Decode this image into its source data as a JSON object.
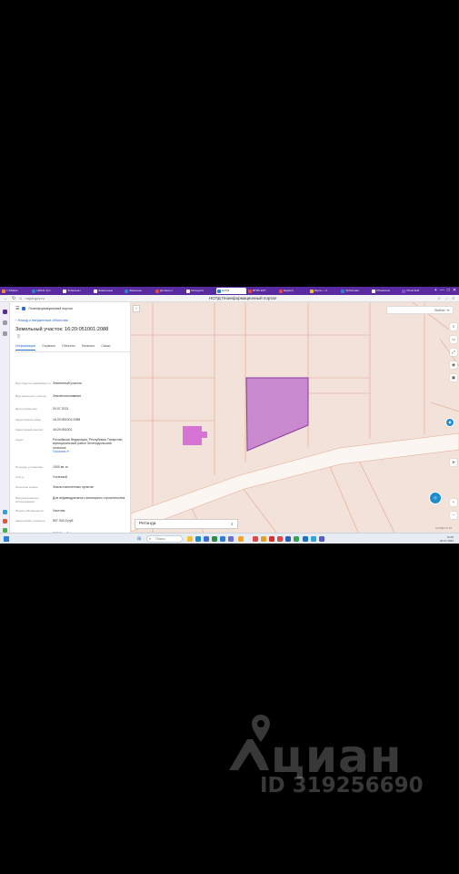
{
  "browser": {
    "tabs": [
      {
        "label": "Р. Абакан",
        "color": "#f28b30"
      },
      {
        "label": "ЦИАН: Куп",
        "color": "#2b7fd6"
      },
      {
        "label": "Земельны",
        "color": "#ffffff"
      },
      {
        "label": "Земельные",
        "color": "#ffffff"
      },
      {
        "label": "Земельны",
        "color": "#2b7fd6"
      },
      {
        "label": "Договор о",
        "color": "#e04848"
      },
      {
        "label": "Калькулят",
        "color": "#ffffff"
      },
      {
        "label": "НСПД",
        "color": "#2b7fd6",
        "active": true
      },
      {
        "label": "ФГИС ЕГР",
        "color": "#e04848"
      },
      {
        "label": "Кадастр",
        "color": "#e04848"
      },
      {
        "label": "Карта — 2",
        "color": "#f2c230"
      },
      {
        "label": "Публичная",
        "color": "#2b7fd6"
      },
      {
        "label": "Объявлени",
        "color": "#ffffff"
      },
      {
        "label": "Photo Edit",
        "color": "#8a4ad6"
      }
    ],
    "window_controls": [
      "+",
      "—",
      "□",
      "✕"
    ],
    "url": "nspd.gov.ru",
    "page_title": "НСПД Геоинформационный портал"
  },
  "panel": {
    "brand": "Геоинформационный портал",
    "back_link": "Назад к найденным объектам",
    "title": "Земельный участок: 16:20:051001:2088",
    "tabs": [
      "Информация",
      "Сервисы",
      "Объекты",
      "Наличие",
      "Связи"
    ],
    "rows": [
      {
        "label": "Вид объекта недвижимости",
        "value": "Земельный участок"
      },
      {
        "label": "Вид земельного участка",
        "value": "Землепользование"
      },
      {
        "label": "Дата присвоения",
        "value": "20.07.2021"
      },
      {
        "label": "Кадастровый номер",
        "value": "16:20:051001:2088"
      },
      {
        "label": "Кадастровый квартал",
        "value": "16:20:051001"
      },
      {
        "label": "Адрес",
        "value": "Российская Федерация, Республика Татарстан, муниципальный район Зеленодольский, сельское",
        "link": "Показать ▾"
      },
      {
        "label": "Площадь уточненная",
        "value": "1000 кв. м"
      },
      {
        "label": "Статус",
        "value": "Учтенный"
      },
      {
        "label": "Категория земель",
        "value": "Земли населенных пунктов"
      },
      {
        "label": "Вид разрешенного использования",
        "value": "Для индивидуального жилищного строительства"
      },
      {
        "label": "Форма собственности",
        "value": "Частная"
      },
      {
        "label": "Кадастровая стоимость",
        "value": "597 340,3 руб."
      },
      {
        "label": "Удельный показатель",
        "value": "597,34 руб./кв. м"
      }
    ]
  },
  "map": {
    "login": "Войти",
    "layer": "Ретонда",
    "scale": "НСПД 0 5 10",
    "tools": [
      "≡",
      "▭",
      "⤢",
      "◉",
      "▣"
    ],
    "nav_tools": [
      "➤",
      "+",
      "−"
    ],
    "highlight_color": "#c98ad0",
    "selected_color": "#d873d6"
  },
  "taskbar": {
    "search_placeholder": "Поиск",
    "time": "11:05",
    "date": "26.07.2024"
  },
  "watermark": {
    "brand": "циан",
    "id": "ID 319256690"
  }
}
